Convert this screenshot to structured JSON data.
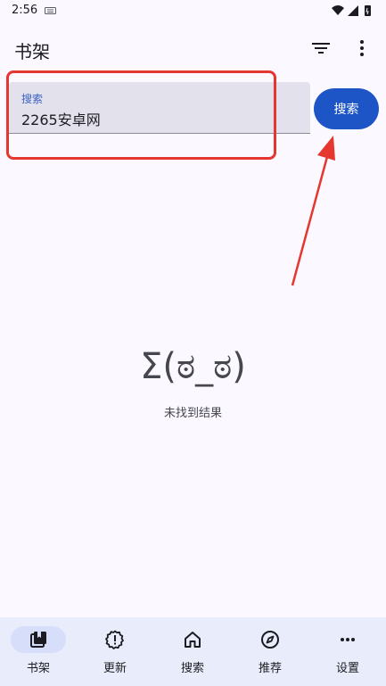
{
  "status_bar": {
    "time": "2:56",
    "icons": [
      "keyboard-icon",
      "wifi-icon",
      "signal-icon",
      "battery-icon"
    ]
  },
  "app_bar": {
    "title": "书架",
    "actions": [
      "filter-icon",
      "more-vert-icon"
    ]
  },
  "search": {
    "label": "搜索",
    "value": "2265安卓网",
    "button_label": "搜索"
  },
  "empty_state": {
    "kaomoji": "Σ(ಠ_ಠ)",
    "message": "未找到结果"
  },
  "bottom_nav": {
    "items": [
      {
        "label": "书架",
        "icon": "bookshelf-icon",
        "selected": true
      },
      {
        "label": "更新",
        "icon": "update-alert-icon",
        "selected": false
      },
      {
        "label": "搜索",
        "icon": "home-icon",
        "selected": false
      },
      {
        "label": "推荐",
        "icon": "compass-icon",
        "selected": false
      },
      {
        "label": "设置",
        "icon": "more-horiz-icon",
        "selected": false
      }
    ]
  },
  "colors": {
    "accent": "#1d55c6",
    "annotation": "#e5372f",
    "background": "#fbf8ff",
    "nav_background": "#e9ecfa"
  }
}
